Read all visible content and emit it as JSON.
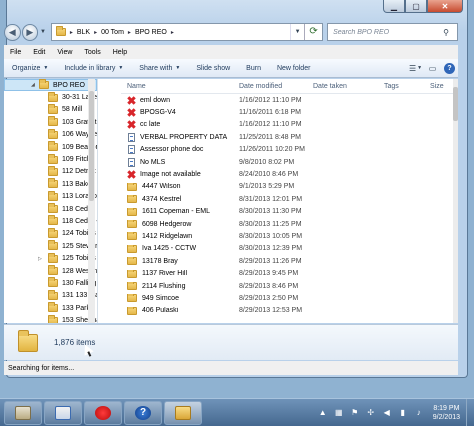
{
  "address": {
    "crumbs": [
      "BLK",
      "00 Tom",
      "BPO REO"
    ],
    "search_placeholder": "Search BPO REO"
  },
  "menu": [
    "File",
    "Edit",
    "View",
    "Tools",
    "Help"
  ],
  "toolbar": {
    "organize": "Organize",
    "include": "Include in library",
    "share": "Share with",
    "slideshow": "Slide show",
    "burn": "Burn",
    "new_folder": "New folder"
  },
  "nav": {
    "root": "BPO REO",
    "items": [
      "30-31 Lakevie",
      "58 Mill",
      "103 Gratiot",
      "106 Wayne",
      "109 Beacon P",
      "109 Fitch",
      "112 Detroit",
      "113 Baker",
      "113 Lorado",
      "118 Cedar",
      "118 Cedar - E",
      "124 Tobias",
      "125 Stewart",
      "125 Tobias",
      "128 Westmor",
      "130 Falling Le",
      "131 133 Mapl",
      "133 Park",
      "153 Sherman"
    ]
  },
  "columns": {
    "name": "Name",
    "date": "Date modified",
    "taken": "Date taken",
    "tags": "Tags",
    "size": "Size"
  },
  "files": [
    {
      "name": "eml down",
      "date": "1/16/2012 11:10 PM",
      "icon": "red-x-icon"
    },
    {
      "name": "BPOSG-V4",
      "date": "11/16/2011 6:18 PM",
      "icon": "red-x-icon"
    },
    {
      "name": "cc late",
      "date": "1/16/2012 11:10 PM",
      "icon": "red-x-icon"
    },
    {
      "name": "VERBAL PROPERTY DATA",
      "date": "11/25/2011 8:48 PM",
      "icon": "document-icon"
    },
    {
      "name": "Assessor phone doc",
      "date": "11/26/2011 10:20 PM",
      "icon": "document-icon"
    },
    {
      "name": "No MLS",
      "date": "9/8/2010 8:02 PM",
      "icon": "document-icon"
    },
    {
      "name": "Image not available",
      "date": "8/24/2010 8:46 PM",
      "icon": "red-x-icon"
    },
    {
      "name": "4447 Wilson",
      "date": "9/1/2013 5:29 PM",
      "icon": "folder-icon"
    },
    {
      "name": "4374 Kestrel",
      "date": "8/31/2013 12:01 PM",
      "icon": "folder-icon"
    },
    {
      "name": "1611 Copeman - EML",
      "date": "8/30/2013 11:30 PM",
      "icon": "folder-icon"
    },
    {
      "name": "6098 Hedgerow",
      "date": "8/30/2013 11:25 PM",
      "icon": "folder-icon"
    },
    {
      "name": "1412 Ridgelawn",
      "date": "8/30/2013 10:05 PM",
      "icon": "folder-icon"
    },
    {
      "name": "Iva 1425 - CCTW",
      "date": "8/30/2013 12:39 PM",
      "icon": "folder-icon"
    },
    {
      "name": "13178 Bray",
      "date": "8/29/2013 11:26 PM",
      "icon": "folder-icon"
    },
    {
      "name": "1137 River Hill",
      "date": "8/29/2013 9:45 PM",
      "icon": "folder-icon"
    },
    {
      "name": "2114 Flushing",
      "date": "8/29/2013 8:46 PM",
      "icon": "folder-icon"
    },
    {
      "name": "949 Simcoe",
      "date": "8/29/2013 2:50 PM",
      "icon": "folder-icon"
    },
    {
      "name": "406 Pulaski",
      "date": "8/29/2013 12:53 PM",
      "icon": "folder-icon"
    }
  ],
  "details": {
    "count": "1,876 items"
  },
  "status": "Searching for items...",
  "clock": {
    "time": "8:19 PM",
    "date": "9/2/2013"
  }
}
